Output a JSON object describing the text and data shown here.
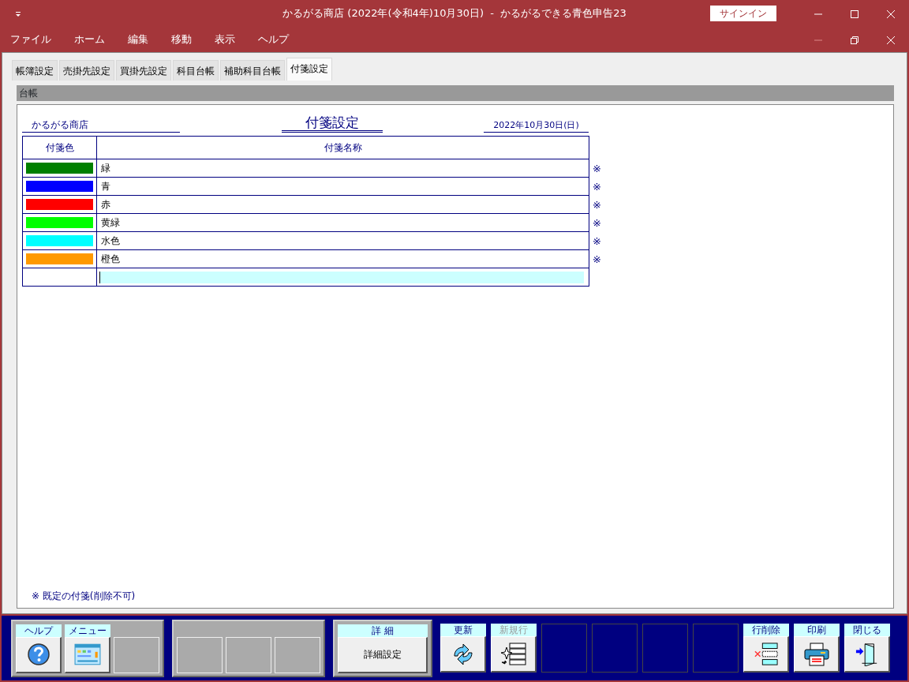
{
  "window": {
    "title": "かるがる商店 (2022年(令和4年)10月30日)  -  かるがるできる青色申告23",
    "signin": "サインイン"
  },
  "menu": [
    "ファイル",
    "ホーム",
    "編集",
    "移動",
    "表示",
    "ヘルプ"
  ],
  "tabs": [
    {
      "label": "帳簿設定",
      "selected": false
    },
    {
      "label": "売掛先設定",
      "selected": false
    },
    {
      "label": "買掛先設定",
      "selected": false
    },
    {
      "label": "科目台帳",
      "selected": false
    },
    {
      "label": "補助科目台帳",
      "selected": false
    },
    {
      "label": "付箋設定",
      "selected": true
    }
  ],
  "section_header": "台帳",
  "report": {
    "title": "付箋設定",
    "company": "かるがる商店",
    "date": "2022年10月30日(日)",
    "columns": [
      "付箋色",
      "付箋名称"
    ],
    "rows": [
      {
        "color": "#008000",
        "name": "緑",
        "mark": "※"
      },
      {
        "color": "#0000ff",
        "name": "青",
        "mark": "※"
      },
      {
        "color": "#ff0000",
        "name": "赤",
        "mark": "※"
      },
      {
        "color": "#00ff00",
        "name": "黄緑",
        "mark": "※"
      },
      {
        "color": "#00ffff",
        "name": "水色",
        "mark": "※"
      },
      {
        "color": "#ff9900",
        "name": "橙色",
        "mark": "※"
      }
    ],
    "new_row": {
      "focused": true
    },
    "footnote": "※ 既定の付箋(削除不可)"
  },
  "toolbar": [
    {
      "kind": "panel",
      "buttons": [
        {
          "kind": "help",
          "label": "ヘルプ",
          "disabled": false
        },
        {
          "kind": "menu",
          "label": "メニュー",
          "disabled": false
        },
        {
          "kind": "blank"
        }
      ]
    },
    {
      "kind": "panel",
      "buttons": [
        {
          "kind": "blank"
        },
        {
          "kind": "blank"
        },
        {
          "kind": "blank"
        }
      ]
    },
    {
      "kind": "panel",
      "buttons": [
        {
          "kind": "text",
          "label": "詳 細",
          "text": "詳細設定",
          "disabled": false
        }
      ]
    },
    {
      "kind": "loose",
      "buttons": [
        {
          "kind": "refresh",
          "label": "更新",
          "disabled": false
        },
        {
          "kind": "newrow",
          "label": "新規行",
          "disabled": true
        },
        {
          "kind": "empty"
        },
        {
          "kind": "empty"
        },
        {
          "kind": "empty"
        },
        {
          "kind": "empty"
        },
        {
          "kind": "deleterow",
          "label": "行削除",
          "disabled": false
        },
        {
          "kind": "print",
          "label": "印刷",
          "disabled": false
        },
        {
          "kind": "close",
          "label": "閉じる",
          "disabled": false
        }
      ]
    }
  ]
}
